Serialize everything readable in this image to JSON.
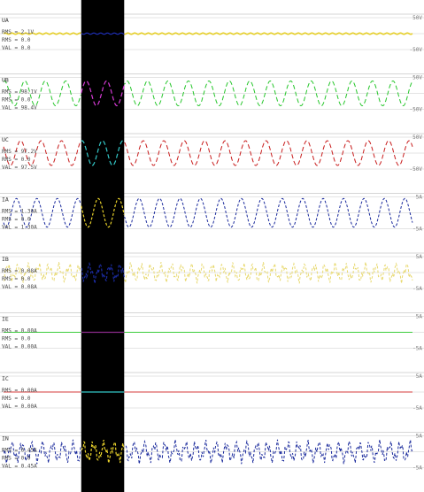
{
  "channels": [
    {
      "name": "UA",
      "rms": "RMS = 2.1V",
      "slot_label": "VAL = 0.0",
      "rms2": "RMS = 0.0",
      "scale_top": "50V",
      "scale_bottom": "-50V",
      "trace_color": "#e6cf2a",
      "highlight_color": "#1f2fb8",
      "waveform": "flat",
      "amplitude": 0.04,
      "cycles": 30
    },
    {
      "name": "UB",
      "rms": "RMS = 98.1V",
      "slot_label": "VAL = 98.4V",
      "rms2": "RMS = 0.0",
      "scale_top": "50V",
      "scale_bottom": "-50V",
      "trace_color": "#25c62a",
      "highlight_color": "#d43ad4",
      "waveform": "sine",
      "amplitude": 0.78,
      "cycles": 20
    },
    {
      "name": "UC",
      "rms": "RMS = 97.2V",
      "slot_label": "VAL = 97.5V",
      "rms2": "RMS = 0.0",
      "scale_top": "50V",
      "scale_bottom": "-50V",
      "trace_color": "#c81c1c",
      "highlight_color": "#33c8c8",
      "waveform": "sine",
      "amplitude": 0.78,
      "cycles": 20
    },
    {
      "name": "IA",
      "rms": "RMS = 1.30A",
      "slot_label": "VAL = 1.30A",
      "rms2": "RMS = 0.0",
      "scale_top": "5A",
      "scale_bottom": "-5A",
      "trace_color": "#1a2a9c",
      "highlight_color": "#e6cf2a",
      "waveform": "sine_dashed",
      "amplitude": 0.9,
      "cycles": 20
    },
    {
      "name": "IB",
      "rms": "RMS = 0.08A",
      "slot_label": "VAL = 0.08A",
      "rms2": "RMS = 0.0",
      "scale_top": "5A",
      "scale_bottom": "-5A",
      "trace_color": "#e8d970",
      "highlight_color": "#1a2a9c",
      "waveform": "noise",
      "amplitude": 0.7,
      "cycles": 40
    },
    {
      "name": "IE",
      "rms": "RMS = 0.00A",
      "slot_label": "VAL = 0.00A",
      "rms2": "RMS = 0.0",
      "scale_top": "5A",
      "scale_bottom": "-5A",
      "trace_color": "#3ccc3c",
      "highlight_color": "#8a2a8a",
      "waveform": "flat",
      "amplitude": 0.0,
      "cycles": 1
    },
    {
      "name": "IC",
      "rms": "RMS = 0.00A",
      "slot_label": "VAL = 0.00A",
      "rms2": "RMS = 0.0",
      "scale_top": "5A",
      "scale_bottom": "-5A",
      "trace_color": "#d43a3a",
      "highlight_color": "#33c8c8",
      "waveform": "flat",
      "amplitude": 0.0,
      "cycles": 1
    },
    {
      "name": "IN",
      "rms": "RMS = 0.45A",
      "slot_label": "VAL = 0.45A",
      "rms2": "RMS = 0.0",
      "scale_top": "5A",
      "scale_bottom": "-5A",
      "trace_color": "#1a2a9c",
      "highlight_color": "#e6cf2a",
      "waveform": "noise",
      "amplitude": 0.8,
      "cycles": 40
    }
  ],
  "cursor": {
    "color": "#000000",
    "start_fraction": 0.19,
    "end_fraction": 0.295
  },
  "colors": {
    "background": "#ffffff",
    "grid": "#c8c8c8",
    "label": "#4a4a4a"
  }
}
